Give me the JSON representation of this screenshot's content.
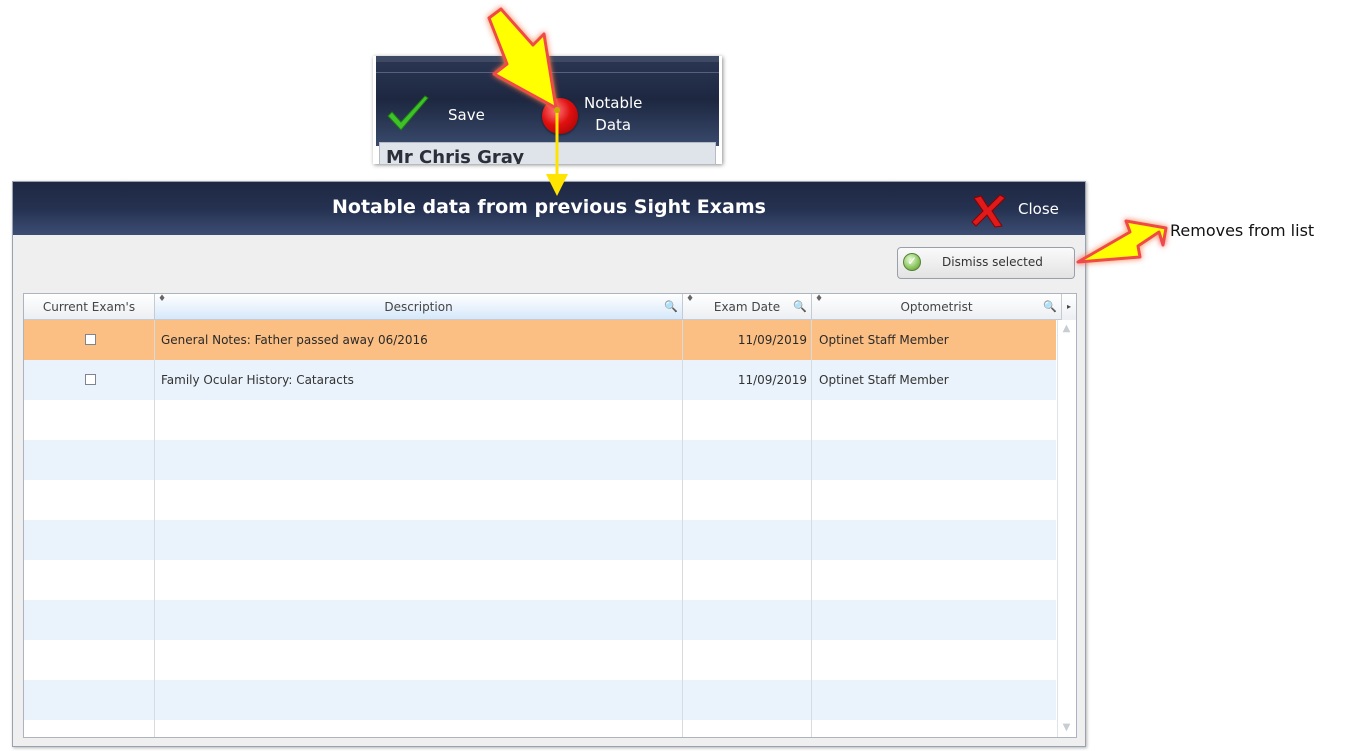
{
  "toolbar": {
    "save_label": "Save",
    "notable_line1": "Notable",
    "notable_line2": "Data",
    "patient_name": "Mr Chris Gray"
  },
  "dialog": {
    "title": "Notable data from previous Sight Exams",
    "close_label": "Close",
    "dismiss_label": "Dismiss selected"
  },
  "grid": {
    "columns": [
      {
        "label": "Current Exam's"
      },
      {
        "label": "Description"
      },
      {
        "label": "Exam Date"
      },
      {
        "label": "Optometrist"
      }
    ],
    "rows": [
      {
        "description": "General Notes: Father passed away 06/2016",
        "exam_date": "11/09/2019",
        "optometrist": "Optinet Staff Member",
        "checked": false,
        "selected": true
      },
      {
        "description": "Family Ocular History: Cataracts",
        "exam_date": "11/09/2019",
        "optometrist": "Optinet Staff Member",
        "checked": false,
        "selected": false
      }
    ]
  },
  "annotation": {
    "removes_text": "Removes from list"
  },
  "icons": {
    "save": "checkmark-icon",
    "notable": "red-dot-icon",
    "close": "red-x-icon",
    "dismiss": "green-check-circle-icon",
    "filter": "magnifier-icon"
  },
  "colors": {
    "titlebar": "#253150",
    "selected_row": "#fbbf84",
    "alt_row": "#eaf3fb",
    "arrow": "#ffff00"
  }
}
